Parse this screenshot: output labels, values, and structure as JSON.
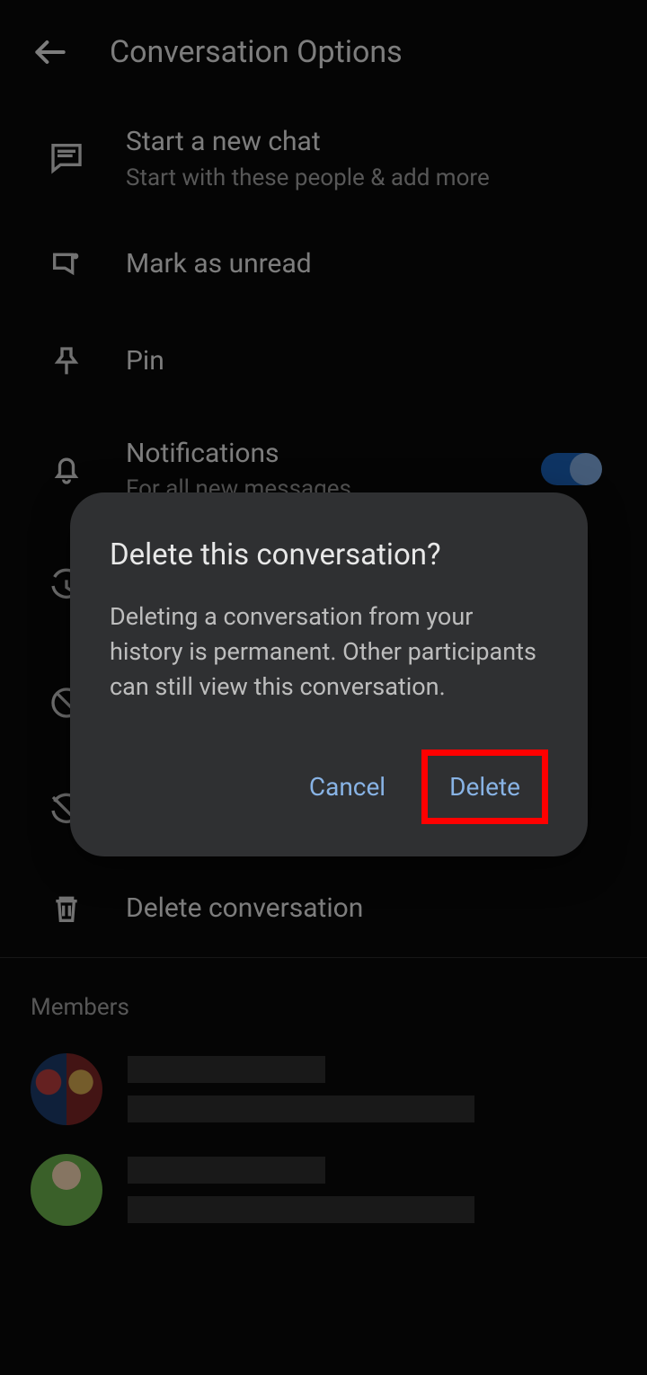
{
  "header": {
    "title": "Conversation Options"
  },
  "options": {
    "newChat": {
      "title": "Start a new chat",
      "sub": "Start with these people & add more"
    },
    "markUnread": {
      "title": "Mark as unread"
    },
    "pin": {
      "title": "Pin"
    },
    "notifications": {
      "title": "Notifications",
      "sub": "For all new messages"
    },
    "delete": {
      "title": "Delete conversation"
    }
  },
  "sections": {
    "members": "Members"
  },
  "dialog": {
    "title": "Delete this conversation?",
    "body": "Deleting a conversation from your history is permanent. Other participants can still view this conversation.",
    "cancel": "Cancel",
    "confirm": "Delete"
  }
}
